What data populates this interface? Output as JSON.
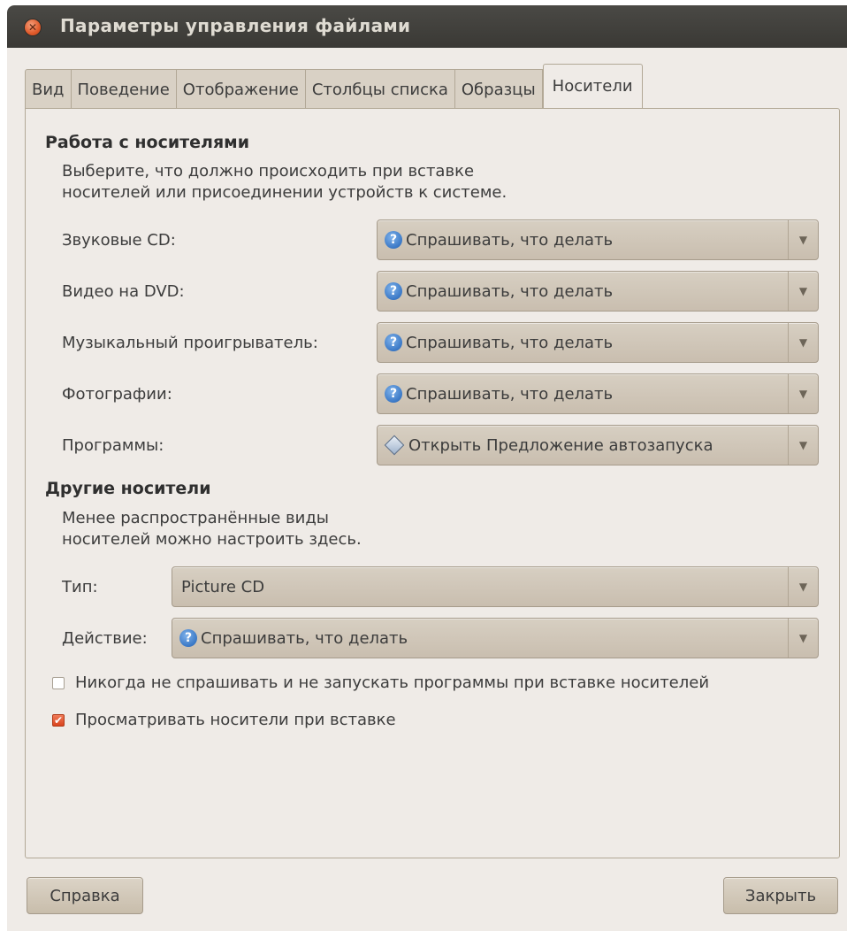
{
  "window": {
    "title": "Параметры управления файлами"
  },
  "tabs": [
    {
      "label": "Вид"
    },
    {
      "label": "Поведение"
    },
    {
      "label": "Отображение"
    },
    {
      "label": "Столбцы списка"
    },
    {
      "label": "Образцы"
    },
    {
      "label": "Носители",
      "active": true
    }
  ],
  "media": {
    "heading": "Работа с носителями",
    "desc_line1": "Выберите, что должно происходить при вставке",
    "desc_line2": "носителей или присоединении устройств к системе.",
    "rows": [
      {
        "label": "Звуковые CD:",
        "value": "Спрашивать, что делать",
        "icon": "question-icon"
      },
      {
        "label": "Видео на DVD:",
        "value": "Спрашивать, что делать",
        "icon": "question-icon"
      },
      {
        "label": "Музыкальный проигрыватель:",
        "value": "Спрашивать, что делать",
        "icon": "question-icon"
      },
      {
        "label": "Фотографии:",
        "value": "Спрашивать, что делать",
        "icon": "question-icon"
      },
      {
        "label": "Программы:",
        "value": "Открыть Предложение автозапуска",
        "icon": "autorun-diamond-icon"
      }
    ]
  },
  "other": {
    "heading": "Другие носители",
    "desc_line1": "Менее распространённые виды",
    "desc_line2": "носителей можно настроить здесь.",
    "type_label": "Тип:",
    "type_value": "Picture CD",
    "action_label": "Действие:",
    "action_value": "Спрашивать, что делать"
  },
  "checkboxes": {
    "never_ask": {
      "label": "Никогда не спрашивать и не запускать программы при вставке носителей",
      "checked": false
    },
    "browse": {
      "label": "Просматривать носители при вставке",
      "checked": true
    }
  },
  "buttons": {
    "help": "Справка",
    "close": "Закрыть"
  },
  "colors": {
    "titlebar": "#3c3b37",
    "window_bg": "#efebe7",
    "checkbox_accent": "#e0572c",
    "question_icon": "#3a78c6"
  }
}
